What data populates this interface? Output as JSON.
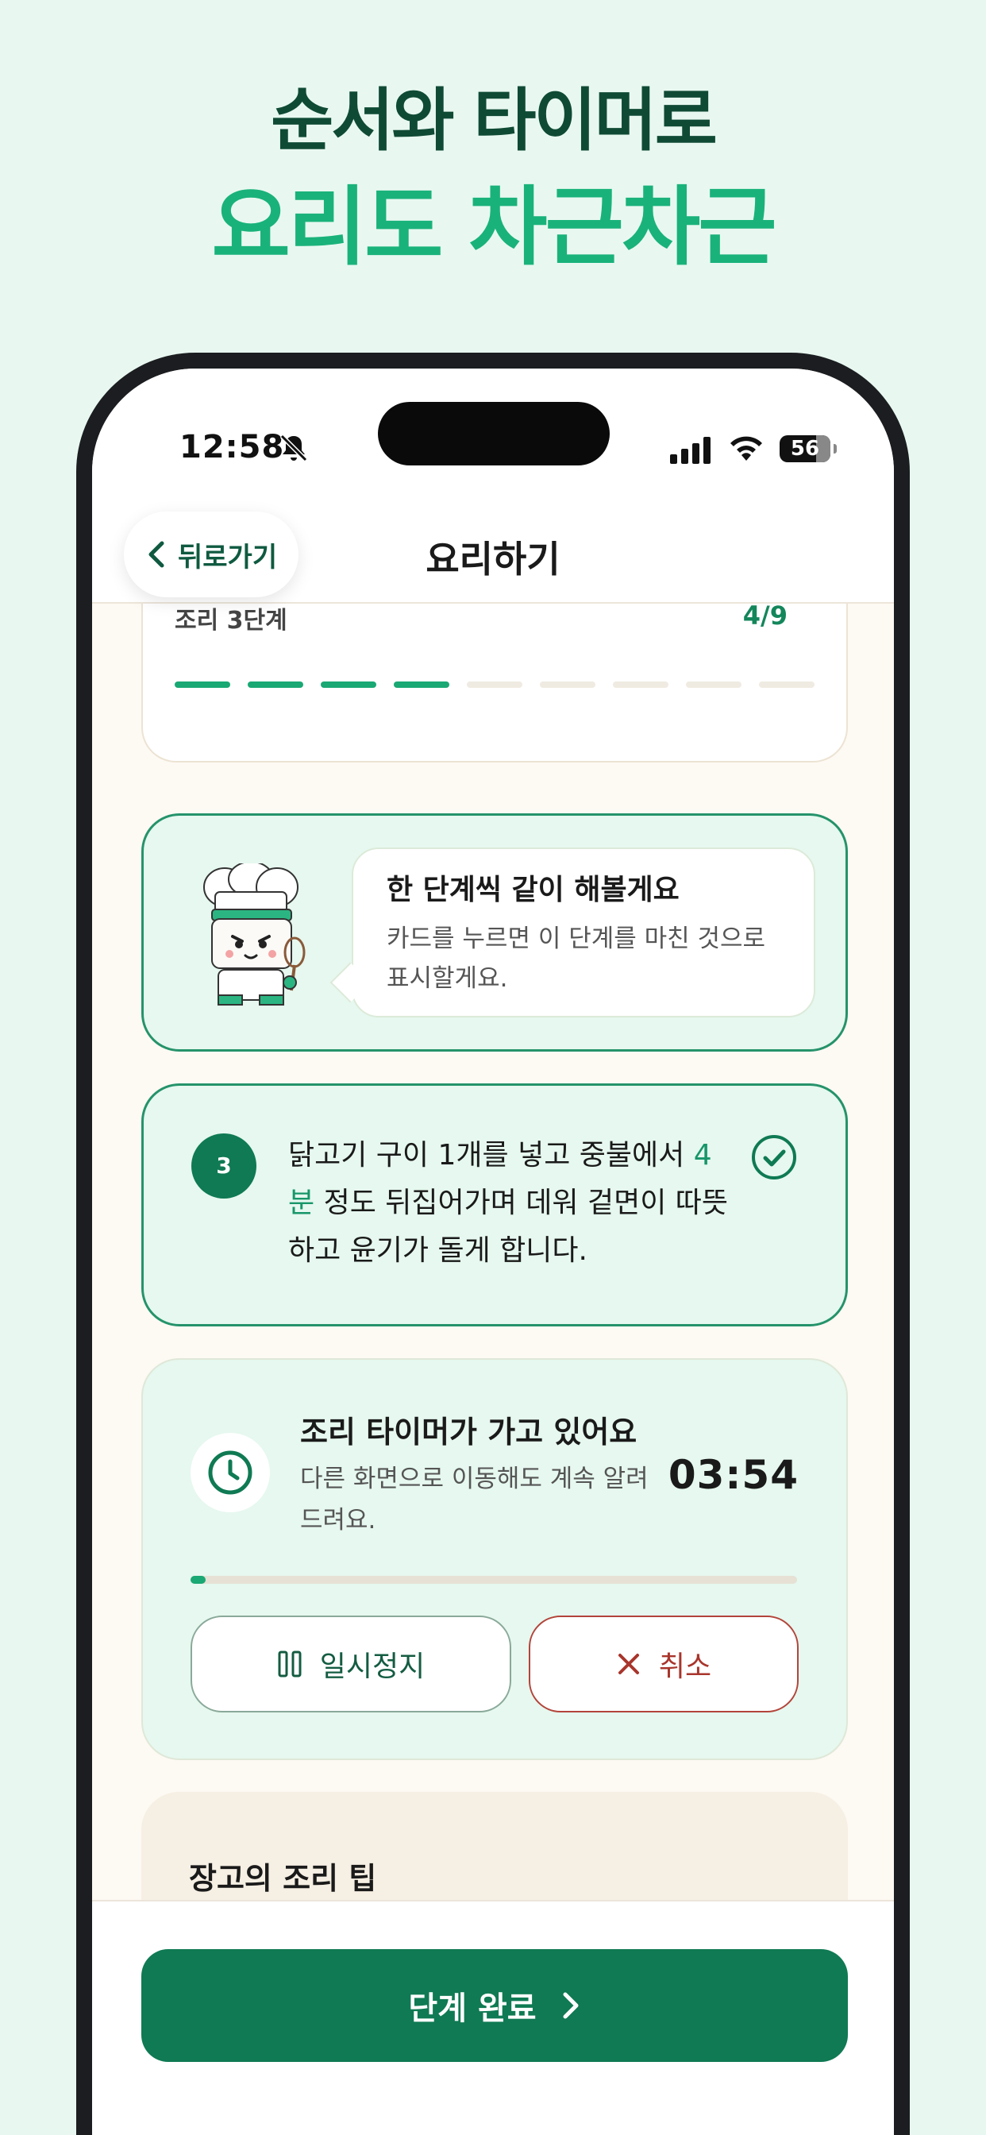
{
  "promo": {
    "line1": "순서와 타이머로",
    "line2": "요리도 차근차근"
  },
  "status_bar": {
    "time": "12:58",
    "battery": "56"
  },
  "header": {
    "back_label": "뒤로가기",
    "title": "요리하기"
  },
  "progress": {
    "label": "조리 3단계",
    "count": "4/9",
    "total_segments": 9,
    "completed_segments": 4
  },
  "chef": {
    "bubble_title": "한 단계씩 같이 해볼게요",
    "bubble_body": "카드를 누르면 이 단계를 마친 것으로 표시할게요."
  },
  "step": {
    "number": "3",
    "text_before": "닭고기 구이 1개를 넣고 중불에서 ",
    "highlight": "4분",
    "text_after": " 정도 뒤집어가며 데워 겉면이 따뜻하고 윤기가 돌게 합니다."
  },
  "timer": {
    "title": "조리 타이머가 가고 있어요",
    "description": "다른 화면으로 이동해도 계속 알려드려요.",
    "value": "03:54",
    "progress_fraction": 0.025,
    "pause_label": "일시정지",
    "cancel_label": "취소"
  },
  "tip": {
    "title": "장고의 조리 팁"
  },
  "footer": {
    "complete_label": "단계 완료"
  },
  "colors": {
    "brand_green": "#0f7a53",
    "accent_green": "#19b27b",
    "cancel_red": "#a8352c",
    "background": "#e8f8f0"
  }
}
